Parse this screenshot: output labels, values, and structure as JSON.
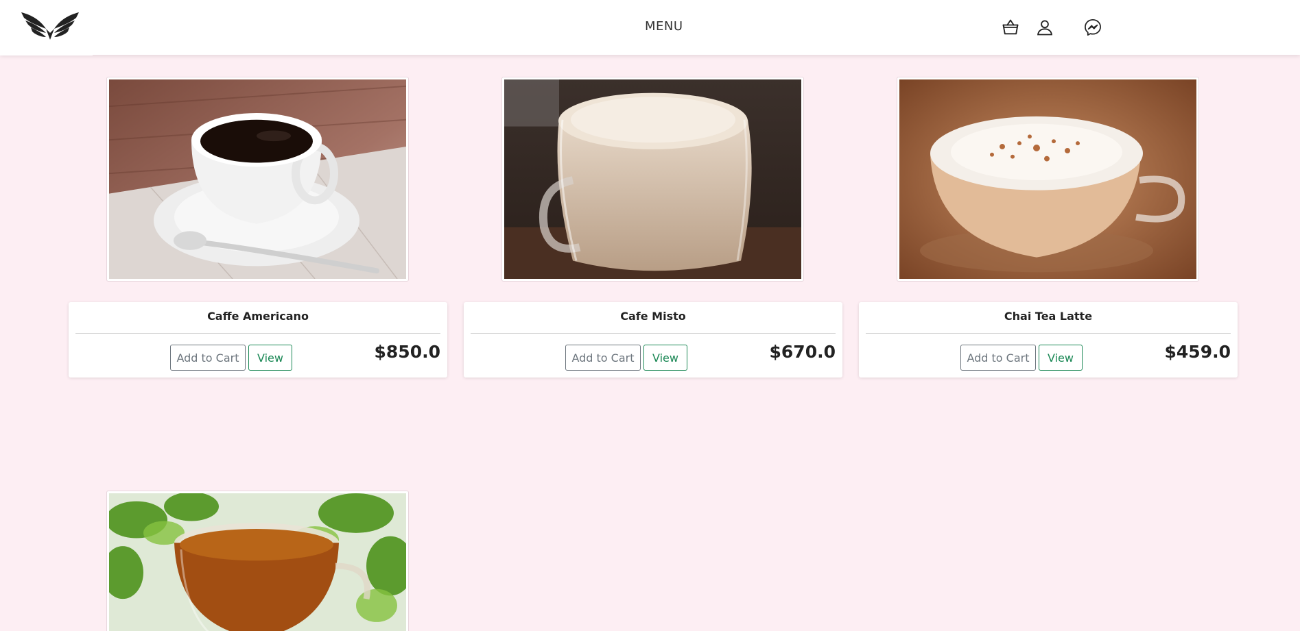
{
  "header": {
    "menu_label": "MENU",
    "icons": [
      "logo-wings",
      "basket-icon",
      "user-icon",
      "messenger-icon"
    ]
  },
  "products": [
    {
      "name": "Caffe Americano",
      "price": "$850.0",
      "add_label": "Add to Cart",
      "view_label": "View",
      "image": "cup of black coffee on saucer"
    },
    {
      "name": "Cafe Misto",
      "price": "$670.0",
      "add_label": "Add to Cart",
      "view_label": "View",
      "image": "glass mug of latte"
    },
    {
      "name": "Chai Tea Latte",
      "price": "$459.0",
      "add_label": "Add to Cart",
      "view_label": "View",
      "image": "glass cup of chai latte with cinnamon foam"
    },
    {
      "name": "",
      "price": "",
      "add_label": "",
      "view_label": "",
      "image": "glass cup of herbal tea with mint leaves"
    }
  ],
  "colors": {
    "page_bg": "#fdeef3",
    "header_bg": "#ffffff",
    "cart_button": "#6c757d",
    "view_button": "#198754"
  }
}
